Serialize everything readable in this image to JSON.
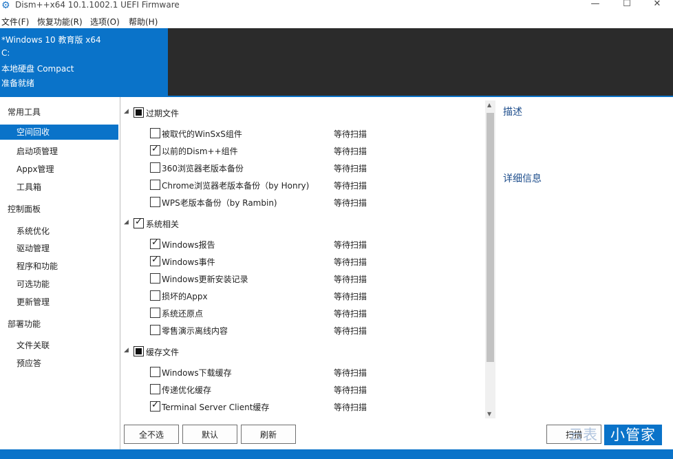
{
  "window": {
    "title": "Dism++x64 10.1.1002.1 UEFI Firmware",
    "controls": {
      "minimize": "—",
      "maximize": "☐",
      "close": "✕"
    }
  },
  "menu": [
    "文件(F)",
    "恢复功能(R)",
    "选项(O)",
    "帮助(H)"
  ],
  "header": {
    "os": "*Windows 10 教育版 x64",
    "drive": "C:",
    "disk": "本地硬盘 Compact",
    "status": "准备就绪"
  },
  "sidebar": {
    "groups": [
      {
        "label": "常用工具",
        "items": [
          "空间回收",
          "启动项管理",
          "Appx管理",
          "工具箱"
        ]
      },
      {
        "label": "控制面板",
        "items": [
          "系统优化",
          "驱动管理",
          "程序和功能",
          "可选功能",
          "更新管理"
        ]
      },
      {
        "label": "部署功能",
        "items": [
          "文件关联",
          "预应答"
        ]
      }
    ],
    "selected": "空间回收"
  },
  "list": {
    "groups": [
      {
        "label": "过期文件",
        "state": "partial",
        "items": [
          {
            "label": "被取代的WinSxS组件",
            "checked": false,
            "status": "等待扫描"
          },
          {
            "label": "以前的Dism++组件",
            "checked": true,
            "status": "等待扫描"
          },
          {
            "label": "360浏览器老版本备份",
            "checked": false,
            "status": "等待扫描"
          },
          {
            "label": "Chrome浏览器老版本备份（by Honry)",
            "checked": false,
            "status": "等待扫描"
          },
          {
            "label": "WPS老版本备份（by Rambin)",
            "checked": false,
            "status": "等待扫描"
          }
        ]
      },
      {
        "label": "系统相关",
        "state": "checked",
        "items": [
          {
            "label": "Windows报告",
            "checked": true,
            "status": "等待扫描"
          },
          {
            "label": "Windows事件",
            "checked": true,
            "status": "等待扫描"
          },
          {
            "label": "Windows更新安装记录",
            "checked": false,
            "status": "等待扫描"
          },
          {
            "label": "损坏的Appx",
            "checked": false,
            "status": "等待扫描"
          },
          {
            "label": "系统还原点",
            "checked": false,
            "status": "等待扫描"
          },
          {
            "label": "零售演示离线内容",
            "checked": false,
            "status": "等待扫描"
          }
        ]
      },
      {
        "label": "缓存文件",
        "state": "partial",
        "items": [
          {
            "label": "Windows下载缓存",
            "checked": false,
            "status": "等待扫描"
          },
          {
            "label": "传递优化缓存",
            "checked": false,
            "status": "等待扫描"
          },
          {
            "label": "Terminal Server Client缓存",
            "checked": true,
            "status": "等待扫描"
          }
        ]
      }
    ]
  },
  "right_panel": {
    "description": "描述",
    "details": "详细信息"
  },
  "buttons": {
    "deselect_all": "全不选",
    "default": "默认",
    "refresh": "刷新",
    "clean": "扫描"
  },
  "watermark": {
    "prefix": "云表",
    "text": "小管家"
  },
  "colors": {
    "accent": "#0a73c9",
    "header_dark": "#2b2b2b"
  }
}
